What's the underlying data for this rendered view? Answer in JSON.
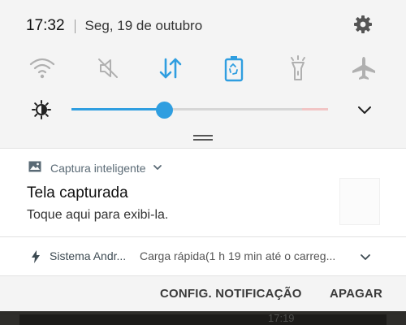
{
  "status": {
    "time": "17:32",
    "date": "Seg, 19 de outubro"
  },
  "quick_toggles": [
    {
      "name": "wifi-icon",
      "active": false
    },
    {
      "name": "mute-icon",
      "active": false
    },
    {
      "name": "data-sync-icon",
      "active": true
    },
    {
      "name": "power-saving-icon",
      "active": true
    },
    {
      "name": "flashlight-icon",
      "active": false
    },
    {
      "name": "airplane-icon",
      "active": false
    }
  ],
  "brightness": {
    "level": 0.36,
    "icon": "brightness-icon"
  },
  "notifications": [
    {
      "app_name": "Captura inteligente",
      "title": "Tela capturada",
      "body": "Toque aqui para exibi-la."
    },
    {
      "app_name": "Sistema Andr...",
      "body": "Carga rápida(1 h 19 min até o carreg..."
    }
  ],
  "actions": {
    "config_label": "CONFIG. NOTIFICAÇÃO",
    "clear_label": "APAGAR"
  },
  "lockscreen_time": "17:19",
  "colors": {
    "accent": "#2f9ee0",
    "panel_bg": "#f4f4f4",
    "inactive_icon": "#b0b0b0"
  }
}
